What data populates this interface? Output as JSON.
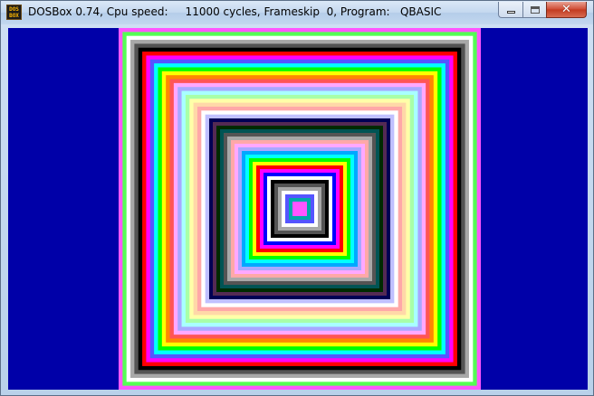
{
  "window": {
    "title": "DOSBox 0.74, Cpu speed:     11000 cycles, Frameskip  0, Program:   QBASIC",
    "icon_text_top": "DOS",
    "icon_text_bottom": "BOX",
    "controls": {
      "minimize_icon": "minimize-icon",
      "maximize_icon": "maximize-icon",
      "close_icon": "close-icon",
      "close_glyph": "✕"
    }
  },
  "screen": {
    "background_color": "#0000a8",
    "graphic": {
      "description_icon": "concentric-squares-graphic",
      "outer_palette": [
        "#ff55ff",
        "#55ff55",
        "#ffffff",
        "#a8a8a8",
        "#545454",
        "#000000",
        "#ff0000",
        "#ff00ff",
        "#5555ff",
        "#00ffff",
        "#00ff00",
        "#ffff00",
        "#ff8800",
        "#ff5555",
        "#ffa8ff",
        "#a8a8ff",
        "#a8ffff",
        "#a8ffa8",
        "#ffffa8",
        "#ffd8a8",
        "#ffa8a8",
        "#ffffff",
        "#c0c0ff"
      ],
      "inner_palette": [
        "#000054",
        "#542a54",
        "#002a00",
        "#005454",
        "#545454",
        "#a8a8a8",
        "#ffa8a8",
        "#ffa8ff",
        "#a8a8ff",
        "#00a8ff",
        "#00ffff",
        "#00ff00",
        "#ffff00",
        "#ff0000",
        "#ff00ff",
        "#0000ff",
        "#ffffff",
        "#000000",
        "#545454",
        "#a8a8a8",
        "#ffffff",
        "#5555ff",
        "#00a8a8",
        "#ff55ff"
      ]
    }
  }
}
